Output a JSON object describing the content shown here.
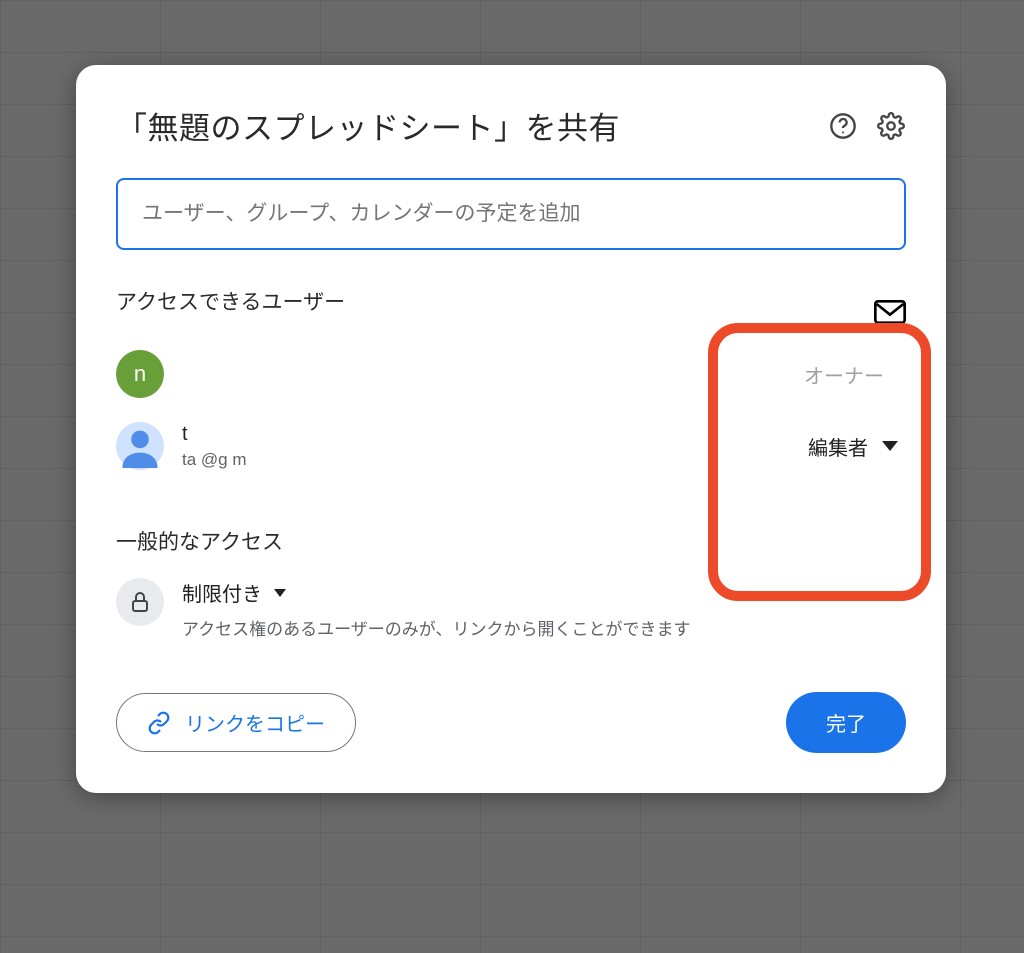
{
  "dialog": {
    "title": "「無題のスプレッドシート」を共有"
  },
  "input": {
    "placeholder": "ユーザー、グループ、カレンダーの予定を追加"
  },
  "sections": {
    "access_title": "アクセスできるユーザー",
    "general_title": "一般的なアクセス"
  },
  "users": [
    {
      "avatar_letter": "n",
      "name": " ",
      "email": " ",
      "role": "オーナー"
    },
    {
      "avatar_letter": "",
      "name": "t",
      "email": "ta                        @g          m",
      "role": "編集者"
    }
  ],
  "general": {
    "mode": "制限付き",
    "description": "アクセス権のあるユーザーのみが、リンクから開くことができます"
  },
  "footer": {
    "copy_link": "リンクをコピー",
    "done": "完了"
  }
}
